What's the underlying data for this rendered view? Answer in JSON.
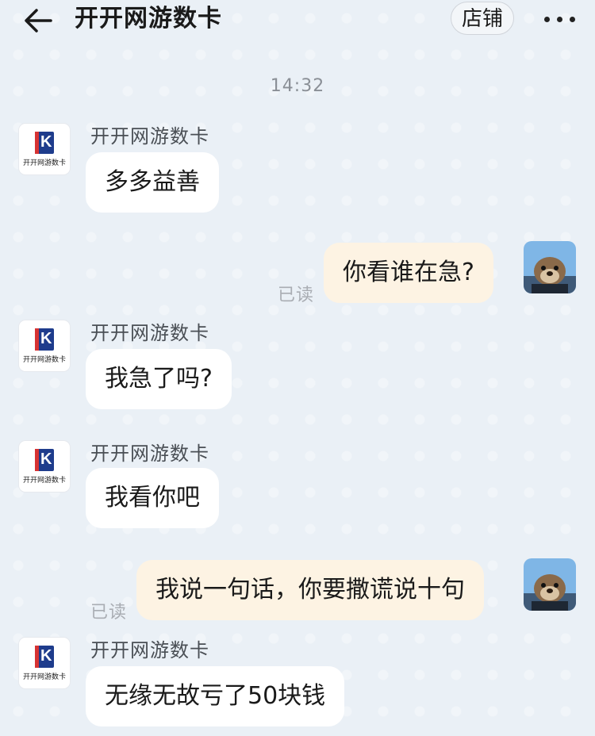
{
  "header": {
    "title": "开开网游数卡",
    "shop_button": "店铺"
  },
  "timestamp": "14:32",
  "shop_avatar_text": "开开网游数卡",
  "messages": [
    {
      "side": "in",
      "sender": "开开网游数卡",
      "text": "多多益善"
    },
    {
      "side": "out",
      "text": "你看谁在急?",
      "status": "已读"
    },
    {
      "side": "in",
      "sender": "开开网游数卡",
      "text": "我急了吗?"
    },
    {
      "side": "in",
      "sender": "开开网游数卡",
      "text": "我看你吧"
    },
    {
      "side": "out",
      "text": "我说一句话，你要撒谎说十句",
      "status": "已读"
    },
    {
      "side": "in",
      "sender": "开开网游数卡",
      "text": "无缘无故亏了50块钱"
    }
  ],
  "colors": {
    "background": "#eaf0f6",
    "incoming_bubble": "#ffffff",
    "outgoing_bubble": "#fdf3e3",
    "logo_blue": "#1e3c8c",
    "logo_red": "#d63333"
  },
  "icons": {
    "back": "arrow-left-icon",
    "more": "more-horizontal-icon"
  }
}
